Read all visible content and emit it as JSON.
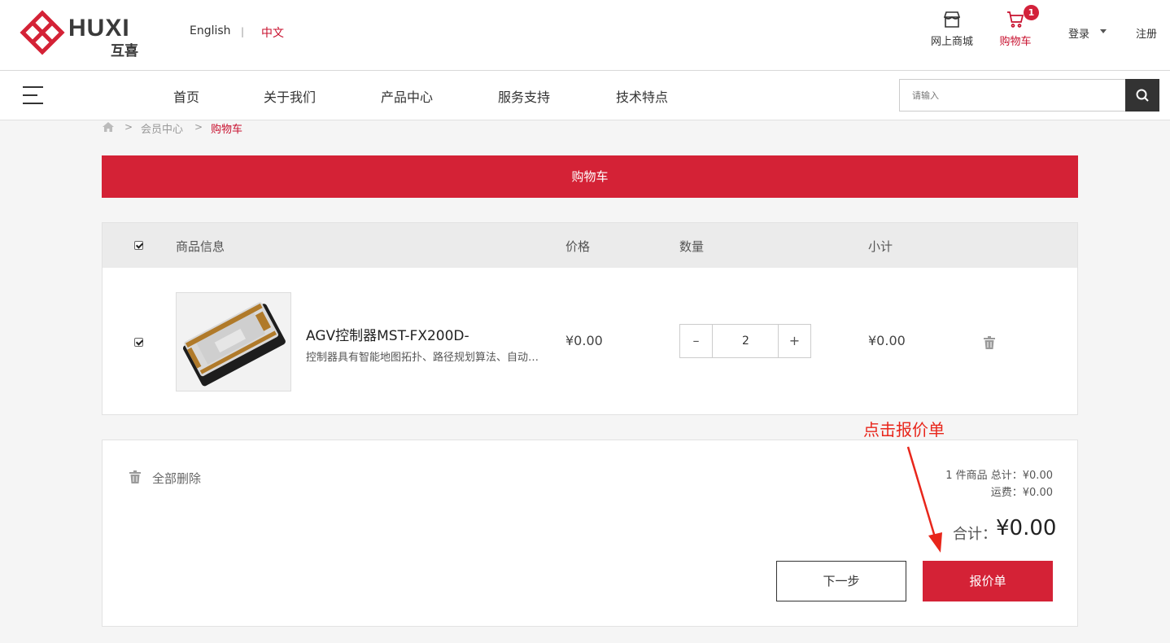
{
  "header": {
    "logo_text": "HUXI",
    "logo_sub": "互喜",
    "lang_en": "English",
    "lang_sep": "|",
    "lang_zh": "中文",
    "mall_label": "网上商城",
    "cart_label": "购物车",
    "cart_count": "1",
    "login_label": "登录",
    "register_label": "注册"
  },
  "nav": {
    "items": [
      "首页",
      "关于我们",
      "产品中心",
      "服务支持",
      "技术特点"
    ],
    "search_placeholder": "请输入"
  },
  "breadcrumb": {
    "member": "会员中心",
    "cart": "购物车",
    "sep": ">"
  },
  "banner": {
    "title": "购物车"
  },
  "table": {
    "headers": {
      "info": "商品信息",
      "price": "价格",
      "qty": "数量",
      "subtotal": "小计"
    },
    "rows": [
      {
        "name": "AGV控制器MST-FX200D-",
        "desc": "控制器具有智能地图拓扑、路径规划算法、自动…",
        "price": "¥0.00",
        "qty": "2",
        "subtotal": "¥0.00"
      }
    ]
  },
  "summary": {
    "delete_all": "全部删除",
    "count_line": "1 件商品 总计：¥0.00",
    "shipping_line": "运费：¥0.00",
    "total_label": "合计：",
    "total_value": "¥0.00",
    "next_button": "下一步",
    "quote_button": "报价单"
  },
  "annotation": {
    "text": "点击报价单"
  },
  "colors": {
    "brand_red": "#d42236",
    "annotation_red": "#e8261b"
  }
}
